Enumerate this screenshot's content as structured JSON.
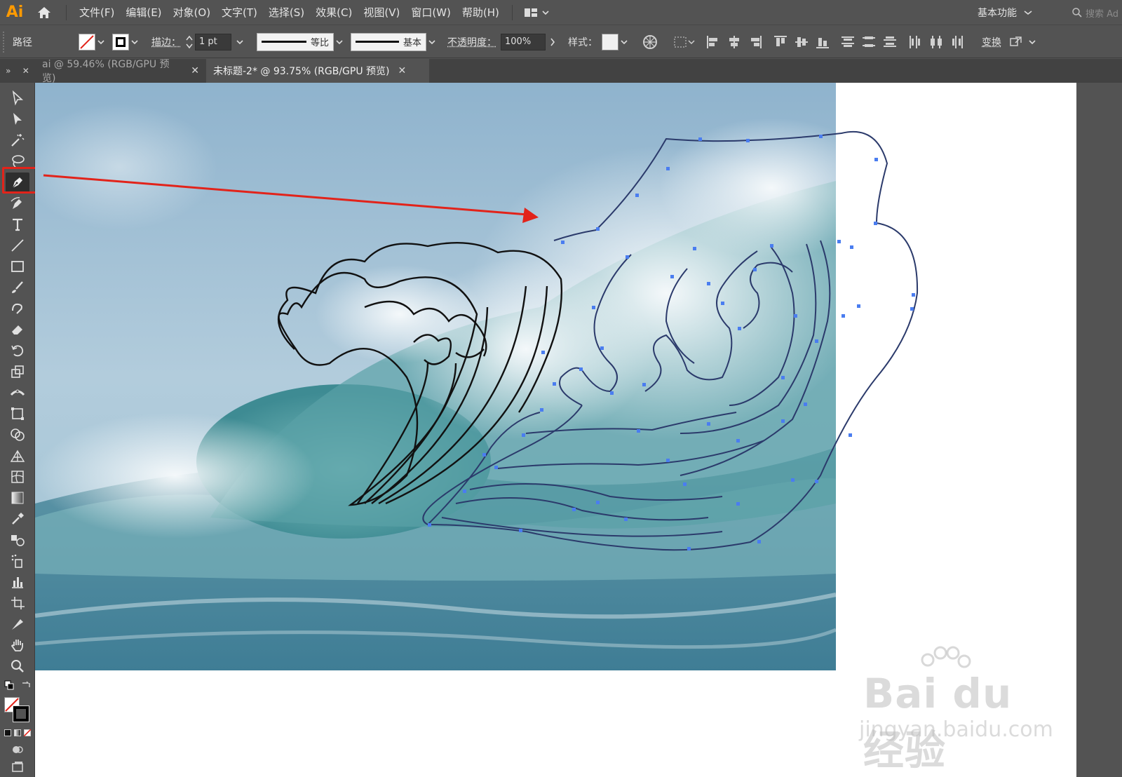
{
  "app": {
    "logo": "Ai"
  },
  "menu": [
    "文件(F)",
    "编辑(E)",
    "对象(O)",
    "文字(T)",
    "选择(S)",
    "效果(C)",
    "视图(V)",
    "窗口(W)",
    "帮助(H)"
  ],
  "workspace": {
    "label": "基本功能"
  },
  "search": {
    "placeholder": "搜索 Ad"
  },
  "control_bar": {
    "object_type": "路径",
    "stroke_label": "描边：",
    "stroke_weight": "1 pt",
    "profile_label": "等比",
    "brush_label": "基本",
    "opacity_label": "不透明度：",
    "opacity_value": "100%",
    "style_label": "样式：",
    "transform_label": "变换"
  },
  "tabs": [
    {
      "label": "ai @ 59.46% (RGB/GPU 预览)",
      "active": false
    },
    {
      "label": "未标题-2* @ 93.75% (RGB/GPU 预览)",
      "active": true
    }
  ],
  "tools": [
    "selection-tool",
    "direct-selection-tool",
    "magic-wand-tool",
    "lasso-tool",
    "pen-tool",
    "curvature-tool",
    "type-tool",
    "line-segment-tool",
    "rectangle-tool",
    "paintbrush-tool",
    "shaper-tool",
    "eraser-tool",
    "rotate-tool",
    "scale-tool",
    "width-tool",
    "free-transform-tool",
    "shape-builder-tool",
    "perspective-grid-tool",
    "mesh-tool",
    "gradient-tool",
    "eyedropper-tool",
    "blend-tool",
    "symbol-sprayer-tool",
    "column-graph-tool",
    "artboard-tool",
    "slice-tool",
    "hand-tool",
    "zoom-tool"
  ],
  "active_tool": "pen-tool",
  "colors": {
    "accent": "#ff9a00",
    "highlight": "#e2231a",
    "path_selected": "#2b3a6b",
    "anchor": "#4a7df0"
  },
  "watermark": {
    "brand": "Bai du 经验",
    "domain": "jingyan.baidu.com"
  }
}
